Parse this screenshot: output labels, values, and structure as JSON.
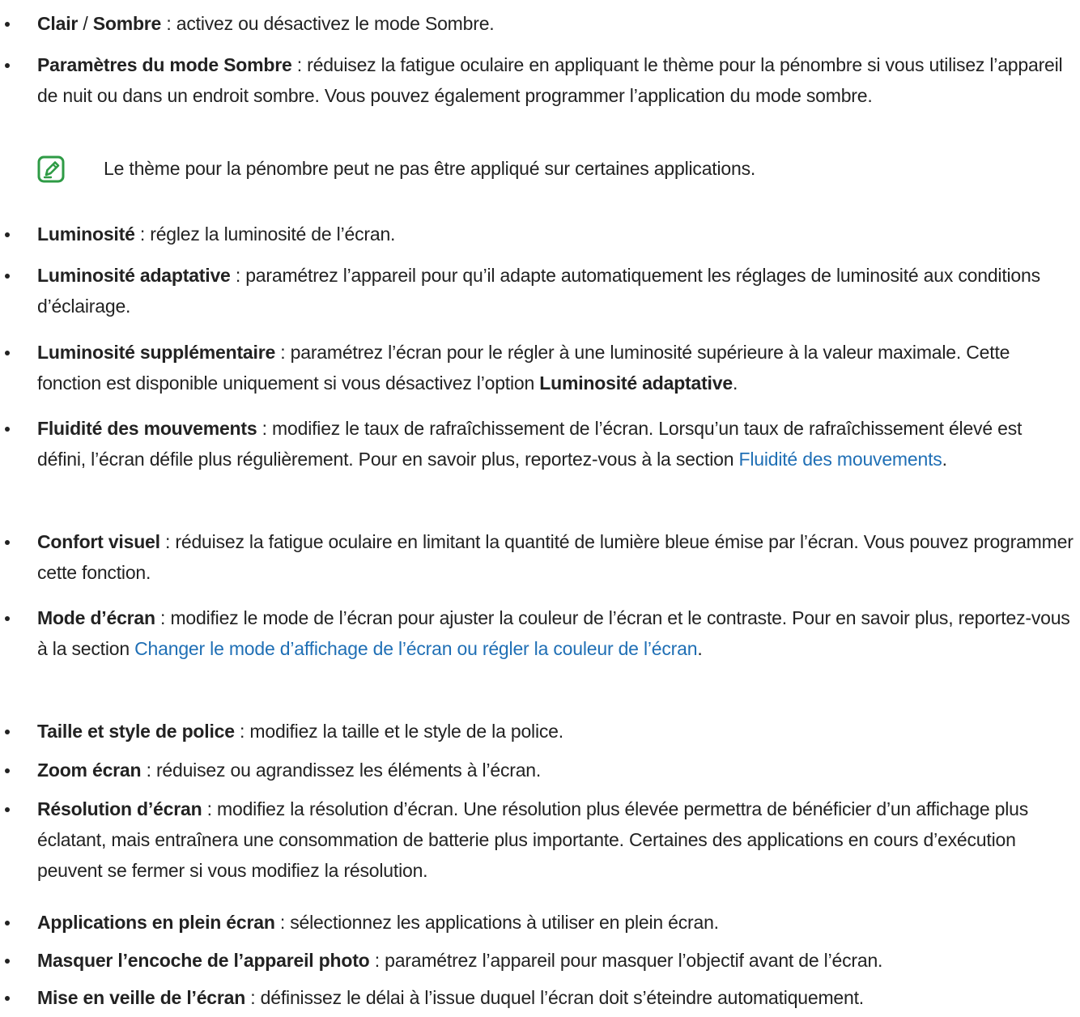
{
  "separator": " : ",
  "slash": " / ",
  "period": ".",
  "items": [
    {
      "term": "Clair",
      "term2": "Sombre",
      "text": "activez ou désactivez le mode Sombre."
    },
    {
      "term": "Paramètres du mode Sombre",
      "text": "réduisez la fatigue oculaire en appliquant le thème pour la pénombre si vous utilisez l’appareil de nuit ou dans un endroit sombre. Vous pouvez également programmer l’application du mode sombre."
    },
    {
      "term": "Luminosité",
      "text": "réglez la luminosité de l’écran."
    },
    {
      "term": "Luminosité adaptative",
      "text": "paramétrez l’appareil pour qu’il adapte automatiquement les réglages de luminosité aux conditions d’éclairage."
    },
    {
      "term": "Luminosité supplémentaire",
      "text": "paramétrez l’écran pour le régler à une luminosité supérieure à la valeur maximale. Cette fonction est disponible uniquement si vous désactivez l’option ",
      "bold_ref": "Luminosité adaptative"
    },
    {
      "term": "Fluidité des mouvements",
      "text": "modifiez le taux de rafraîchissement de l’écran. Lorsqu’un taux de rafraîchissement élevé est défini, l’écran défile plus régulièrement. Pour en savoir plus, reportez-vous à la section ",
      "link": "Fluidité des mouvements"
    },
    {
      "term": "Confort visuel",
      "text": "réduisez la fatigue oculaire en limitant la quantité de lumière bleue émise par l’écran. Vous pouvez programmer cette fonction."
    },
    {
      "term": "Mode d’écran",
      "text": "modifiez le mode de l’écran pour ajuster la couleur de l’écran et le contraste. Pour en savoir plus, reportez-vous à la section ",
      "link": "Changer le mode d’affichage de l’écran ou régler la couleur de l’écran"
    },
    {
      "term": "Taille et style de police",
      "text": "modifiez la taille et le style de la police."
    },
    {
      "term": "Zoom écran",
      "text": "réduisez ou agrandissez les éléments à l’écran."
    },
    {
      "term": "Résolution d’écran",
      "text": "modifiez la résolution d’écran. Une résolution plus élevée permettra de bénéficier d’un affichage plus éclatant, mais entraînera une consommation de batterie plus importante. Certaines des applications en cours d’exécution peuvent se fermer si vous modifiez la résolution."
    },
    {
      "term": "Applications en plein écran",
      "text": "sélectionnez les applications à utiliser en plein écran."
    },
    {
      "term": "Masquer l’encoche de l’appareil photo",
      "text": "paramétrez l’appareil pour masquer l’objectif avant de l’écran."
    },
    {
      "term": "Mise en veille de l’écran",
      "text": "définissez le délai à l’issue duquel l’écran doit s’éteindre automatiquement."
    }
  ],
  "note": {
    "icon": "note-pencil-icon",
    "text": "Le thème pour la pénombre peut ne pas être appliqué sur certaines applications."
  },
  "colors": {
    "text": "#222222",
    "link": "#1f6fb5",
    "note_icon": "#2e9b45"
  }
}
